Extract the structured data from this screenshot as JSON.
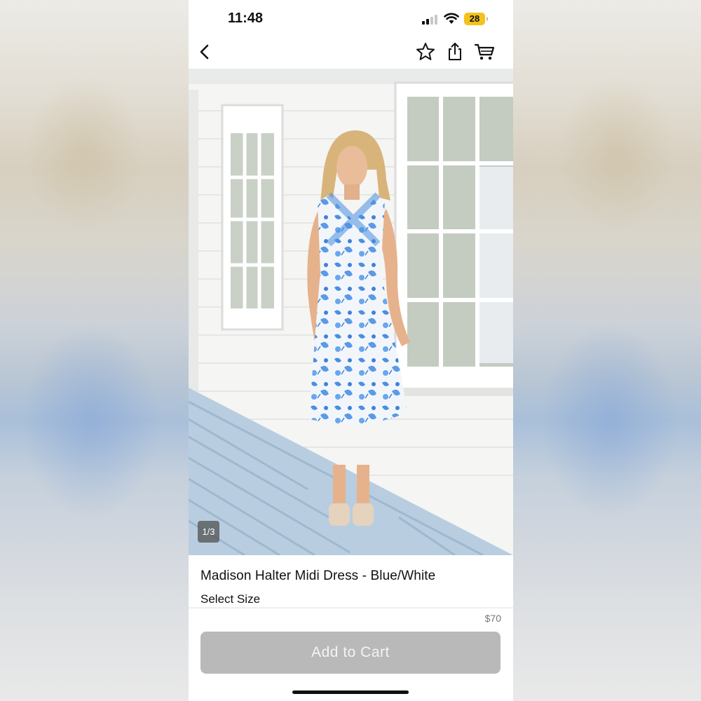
{
  "status_bar": {
    "time": "11:48",
    "battery_level": "28",
    "icons": [
      "cellular-signal-icon",
      "wifi-icon",
      "battery-icon"
    ]
  },
  "nav": {
    "icons": [
      "chevron-left-icon",
      "star-icon",
      "share-icon",
      "cart-icon"
    ]
  },
  "product": {
    "image_counter": "1/3",
    "title": "Madison Halter Midi Dress - Blue/White",
    "select_size_label": "Select Size",
    "price": "$70",
    "add_to_cart_label": "Add to Cart"
  },
  "colors": {
    "battery": "#f4c21b",
    "button_disabled": "#b9b9b9",
    "dress_print": "#4a8fe0"
  }
}
